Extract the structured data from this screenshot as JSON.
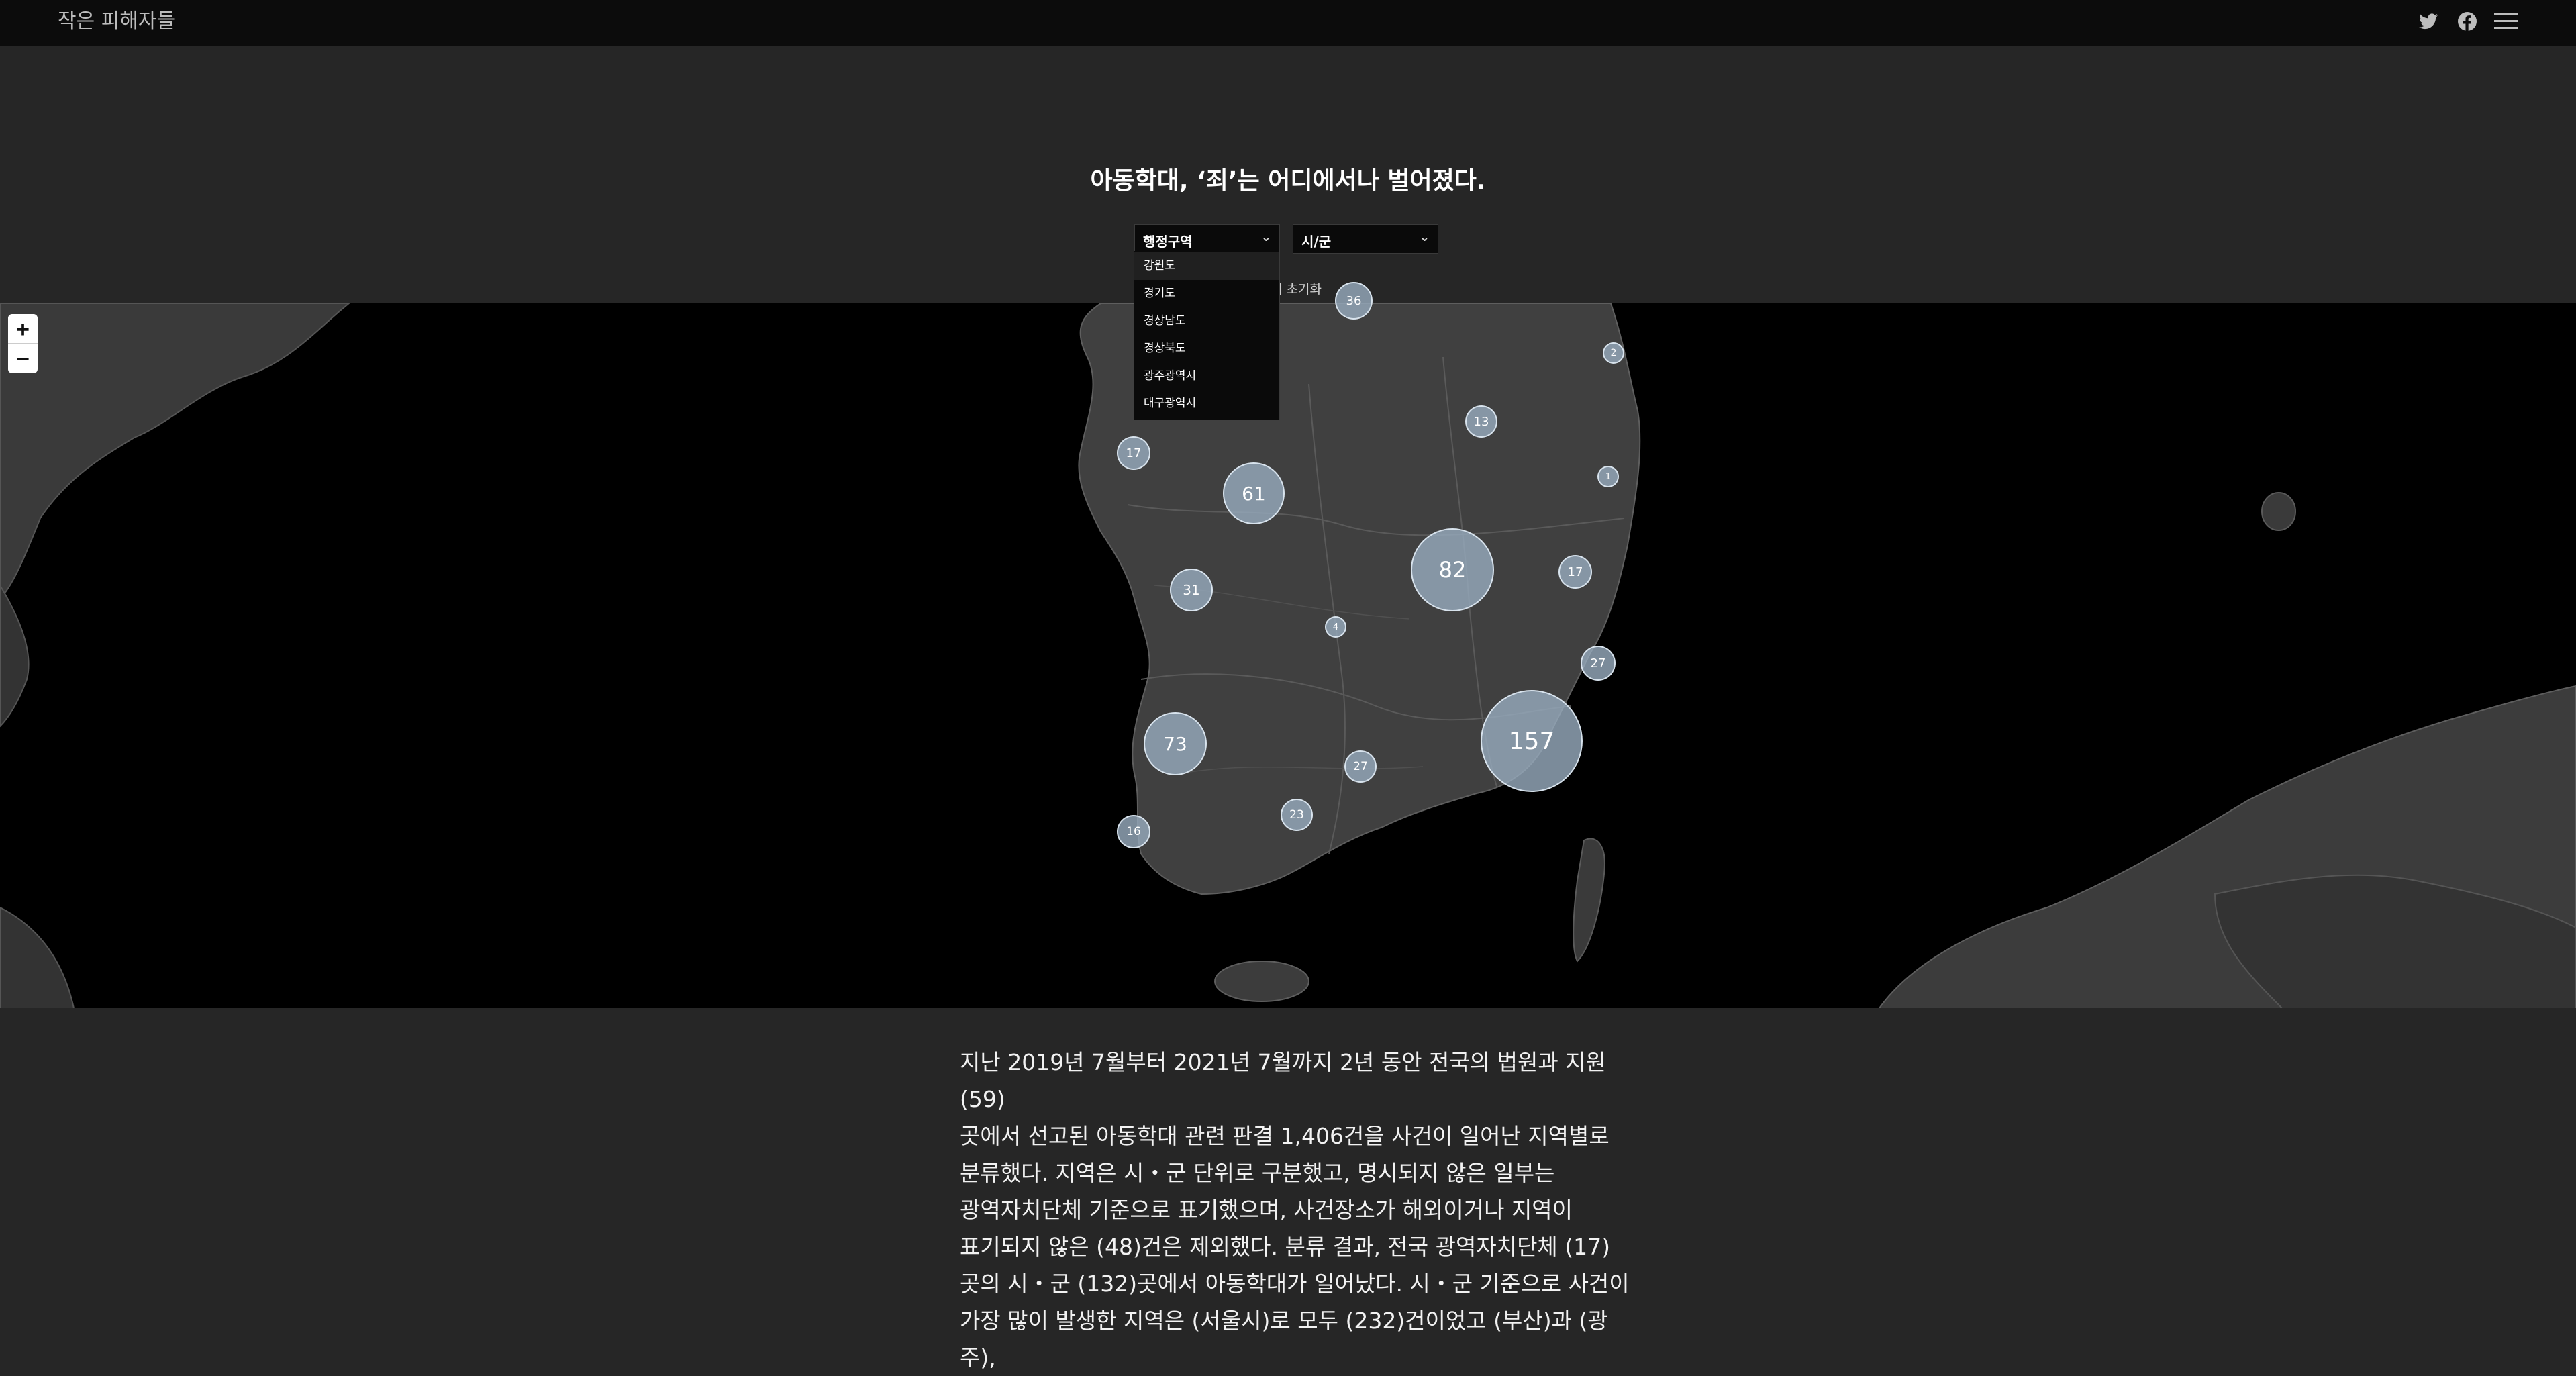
{
  "site": {
    "title": "작은 피해자들"
  },
  "header_icons": [
    "twitter-icon",
    "facebook-icon",
    "menu-icon"
  ],
  "headline": "아동학대, ‘죄’는 어디에서나 벌어졌다.",
  "filters": {
    "region_select": "행정구역",
    "city_select": "시/군",
    "reset_label": "터 초기화",
    "region_options": [
      "강원도",
      "경기도",
      "경상남도",
      "경상북도",
      "광주광역시",
      "대구광역시"
    ],
    "highlighted_option": "강원도"
  },
  "zoom": {
    "in": "+",
    "out": "−"
  },
  "clusters": [
    {
      "label": "36",
      "value": 36
    },
    {
      "label": "2",
      "value": 2
    },
    {
      "label": "13",
      "value": 13
    },
    {
      "label": "17",
      "value": 17
    },
    {
      "label": "61",
      "value": 61
    },
    {
      "label": "1",
      "value": 1
    },
    {
      "label": "82",
      "value": 82
    },
    {
      "label": "17",
      "value": 17
    },
    {
      "label": "31",
      "value": 31
    },
    {
      "label": "4",
      "value": 4
    },
    {
      "label": "27",
      "value": 27
    },
    {
      "label": "157",
      "value": 157
    },
    {
      "label": "73",
      "value": 73
    },
    {
      "label": "27",
      "value": 27
    },
    {
      "label": "23",
      "value": 23
    },
    {
      "label": "16",
      "value": 16
    }
  ],
  "article": {
    "lines": [
      "지난 2019년 7월부터 2021년 7월까지 2년 동안 전국의 법원과 지원 (59)",
      "곳에서 선고된 아동학대 관련 판결 1,406건을 사건이 일어난 지역별로",
      "분류했다. 지역은 시・군 단위로 구분했고, 명시되지 않은 일부는",
      "광역자치단체 기준으로 표기했으며, 사건장소가 해외이거나 지역이",
      "표기되지 않은 (48)건은 제외했다. 분류 결과, 전국 광역자치단체 (17)",
      "곳의 시・군 (132)곳에서 아동학대가 일어났다. 시・군 기준으로 사건이",
      "가장 많이 발생한 지역은 (서울시)로 모두 (232)건이었고 (부산)과 (광주),"
    ]
  }
}
